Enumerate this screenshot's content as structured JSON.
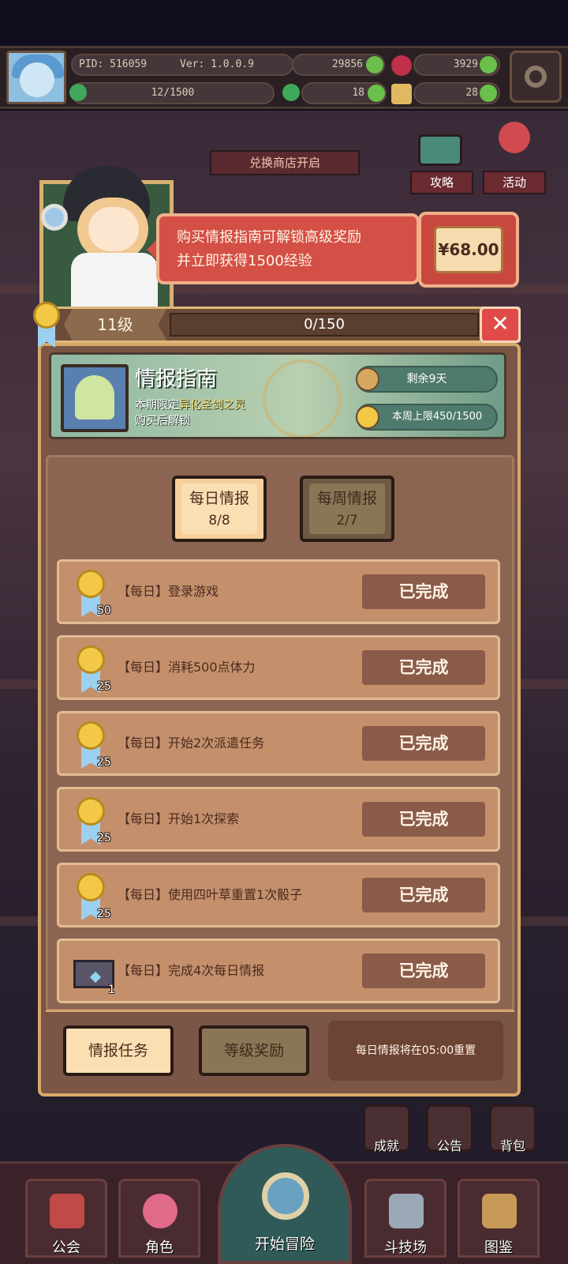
{
  "status": {
    "pid": "PID: 516059",
    "version": "Ver: 1.0.0.9",
    "gold": "29856",
    "gems": "3929",
    "stamina": "12/1500",
    "clover": "18",
    "dice": "28"
  },
  "side_buttons": {
    "shop_banner": "兑换商店开启",
    "strategy": "攻略",
    "events": "活动"
  },
  "purchase": {
    "line1": "购买情报指南可解锁高级奖励",
    "line2": "并立即获得1500经验",
    "price": "¥68.00"
  },
  "level": {
    "label": "11级",
    "progress": "0/150",
    "close": "✕"
  },
  "guide": {
    "title": "情报指南",
    "sub_prefix": "本期限定",
    "sub_highlight": "异化圣剑之灵",
    "sub_line2": "购买后解锁",
    "days_left": "剩余9天",
    "weekly_limit": "本周上限450/1500"
  },
  "tabs": [
    {
      "label": "每日情报",
      "count": "8/8"
    },
    {
      "label": "每周情报",
      "count": "2/7"
    }
  ],
  "tasks": [
    {
      "label": "【每日】登录游戏",
      "reward": "50",
      "reward_icon": "medal-icon",
      "status": "已完成"
    },
    {
      "label": "【每日】消耗500点体力",
      "reward": "25",
      "reward_icon": "medal-icon",
      "status": "已完成"
    },
    {
      "label": "【每日】开始2次派遣任务",
      "reward": "25",
      "reward_icon": "medal-icon",
      "status": "已完成"
    },
    {
      "label": "【每日】开始1次探索",
      "reward": "25",
      "reward_icon": "medal-icon",
      "status": "已完成"
    },
    {
      "label": "【每日】使用四叶草重置1次骰子",
      "reward": "25",
      "reward_icon": "medal-icon",
      "status": "已完成"
    },
    {
      "label": "【每日】完成4次每日情报",
      "reward": "1",
      "reward_icon": "envelope-icon",
      "status": "已完成"
    }
  ],
  "footer": {
    "tasks_tab": "情报任务",
    "rewards_tab": "等级奖励",
    "reset_note": "每日情报将在05:00重置"
  },
  "side_icons": {
    "achievements": "成就",
    "notice": "公告",
    "backpack": "背包"
  },
  "bottom_nav": {
    "guild": "公会",
    "character": "角色",
    "adventure": "开始冒险",
    "arena": "斗技场",
    "codex": "图鉴"
  }
}
